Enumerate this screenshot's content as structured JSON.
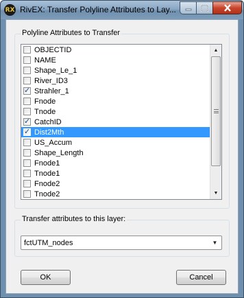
{
  "window": {
    "title": "RivEX: Transfer Polyline Attributes to Lay...",
    "icon_text": "RX"
  },
  "titlebar_buttons": {
    "minimize_icon": "minimize-icon",
    "maximize_icon": "maximize-icon",
    "close_icon": "close-icon"
  },
  "attributes_group": {
    "label": "Polyline Attributes to Transfer",
    "items": [
      {
        "label": "OBJECTID",
        "checked": false
      },
      {
        "label": "NAME",
        "checked": false
      },
      {
        "label": "Shape_Le_1",
        "checked": false
      },
      {
        "label": "River_ID3",
        "checked": false
      },
      {
        "label": "Strahler_1",
        "checked": true
      },
      {
        "label": "Fnode",
        "checked": false
      },
      {
        "label": "Tnode",
        "checked": false
      },
      {
        "label": "CatchID",
        "checked": true
      },
      {
        "label": "Dist2Mth",
        "checked": true,
        "selected": true
      },
      {
        "label": "US_Accum",
        "checked": false
      },
      {
        "label": "Shape_Length",
        "checked": false
      },
      {
        "label": "Fnode1",
        "checked": false
      },
      {
        "label": "Tnode1",
        "checked": false
      },
      {
        "label": "Fnode2",
        "checked": false
      },
      {
        "label": "Tnode2",
        "checked": false
      }
    ]
  },
  "layer_group": {
    "label": "Transfer attributes to this layer:",
    "selected_layer": "fctUTM_nodes"
  },
  "buttons": {
    "ok": "OK",
    "cancel": "Cancel"
  },
  "colors": {
    "selection": "#3399ff",
    "title_bar": "#8aa7c4",
    "close_button": "#c8452d"
  }
}
